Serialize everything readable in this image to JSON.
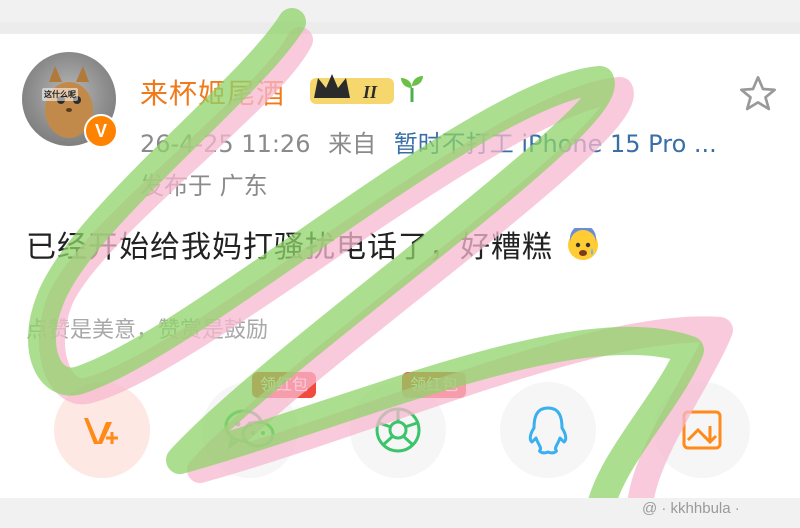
{
  "post": {
    "avatar_caption": "这什么呢",
    "verified_badge": "V",
    "username": "来杯姬尾酒",
    "vip_level": "II",
    "timestamp": "26-4-25 11:26",
    "source_prefix": "来自",
    "source": "暂时不打工 iPhone 15 Pro ...",
    "location": "发布于 广东",
    "content": "已经开始给我妈打骚扰电话了，好糟糕",
    "reward_slogan": "点赞是美意，赞赏是鼓励"
  },
  "share_buttons": [
    {
      "name": "v-plus",
      "icon": "v-plus-icon",
      "tag": ""
    },
    {
      "name": "wechat",
      "icon": "wechat-icon",
      "tag": "领红包"
    },
    {
      "name": "moments",
      "icon": "moments-icon",
      "tag": "领红包"
    },
    {
      "name": "qq",
      "icon": "qq-icon",
      "tag": ""
    },
    {
      "name": "save-image",
      "icon": "save-image-icon",
      "tag": ""
    }
  ],
  "watermark": "@ · kkhhbula ·",
  "colors": {
    "username": "#f07a1a",
    "source_link": "#3a6fa6",
    "red_packet": "#f14a3e",
    "wechat_green": "#3cc46b",
    "qq_blue": "#3ab0f0",
    "scribble_green": "#8fd36a",
    "scribble_pink": "#f7b8cf"
  }
}
